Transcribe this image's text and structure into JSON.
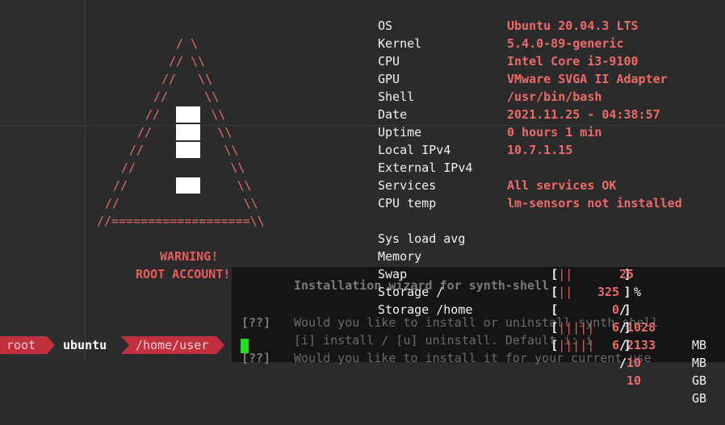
{
  "ascii_art": {
    "lines": [
      "/ \\",
      "// \\\\",
      "//   \\\\",
      "//     \\\\",
      "//       \\\\",
      "//         \\\\",
      "//           \\\\",
      "//             \\\\",
      "//               \\\\",
      "//                 \\\\",
      "//===================\\\\"
    ],
    "warning_line1": "WARNING!",
    "warning_line2": "ROOT ACCOUNT!"
  },
  "sysinfo": {
    "rows": [
      {
        "key": "OS",
        "value": "Ubuntu 20.04.3 LTS"
      },
      {
        "key": "Kernel",
        "value": "5.4.0-89-generic"
      },
      {
        "key": "CPU",
        "value": "Intel Core i3-9100"
      },
      {
        "key": "GPU",
        "value": "VMware SVGA II Adapter"
      },
      {
        "key": "Shell",
        "value": "/usr/bin/bash"
      },
      {
        "key": "Date",
        "value": "2021.11.25 - 04:38:57"
      },
      {
        "key": "Uptime",
        "value": "0 hours 1 min"
      },
      {
        "key": "Local IPv4",
        "value": "10.7.1.15"
      },
      {
        "key": "External IPv4",
        "value": ""
      },
      {
        "key": "Services",
        "value": "All services OK"
      },
      {
        "key": "CPU temp",
        "value": "lm-sensors not installed"
      }
    ],
    "meters": [
      {
        "key": "Sys load avg",
        "bar_open": "[",
        "bar": "||",
        "bar_pad": "       ",
        "bar_close": "]",
        "used": "25",
        "sep": "",
        "total": "",
        "unit": "%"
      },
      {
        "key": "Memory",
        "bar_open": "[",
        "bar": "||",
        "bar_pad": "       ",
        "bar_close": "]",
        "used": "325",
        "sep": "/",
        "total": "1028",
        "unit": "MB"
      },
      {
        "key": "Swap",
        "bar_open": "[",
        "bar": "",
        "bar_pad": "         ",
        "bar_close": "]",
        "used": "0",
        "sep": "/",
        "total": "2133",
        "unit": "MB"
      },
      {
        "key": "Storage /",
        "bar_open": "[",
        "bar": "|||||",
        "bar_pad": "    ",
        "bar_close": "]",
        "used": "6",
        "sep": "/",
        "total": "10",
        "unit": "GB"
      },
      {
        "key": "Storage /home",
        "bar_open": "[",
        "bar": "|||||",
        "bar_pad": "    ",
        "bar_close": "]",
        "used": "6",
        "sep": "/",
        "total": "10",
        "unit": "GB"
      }
    ]
  },
  "installer": {
    "title": "Installation wizard for synth-shell",
    "tag": "[??]",
    "q1": "Would you like to install or uninstall synth-shell",
    "q1_hint": "[i] install / [u] uninstall. Default i: i",
    "q2": "Would you like to install it for your current use"
  },
  "prompt": {
    "user": "root",
    "host": "ubuntu",
    "path": "/home/user"
  },
  "colors": {
    "accent_red": "#e85c5c",
    "prompt_segment": "#c0303f",
    "cursor": "#22dd22",
    "background": "#2b2b2b"
  }
}
